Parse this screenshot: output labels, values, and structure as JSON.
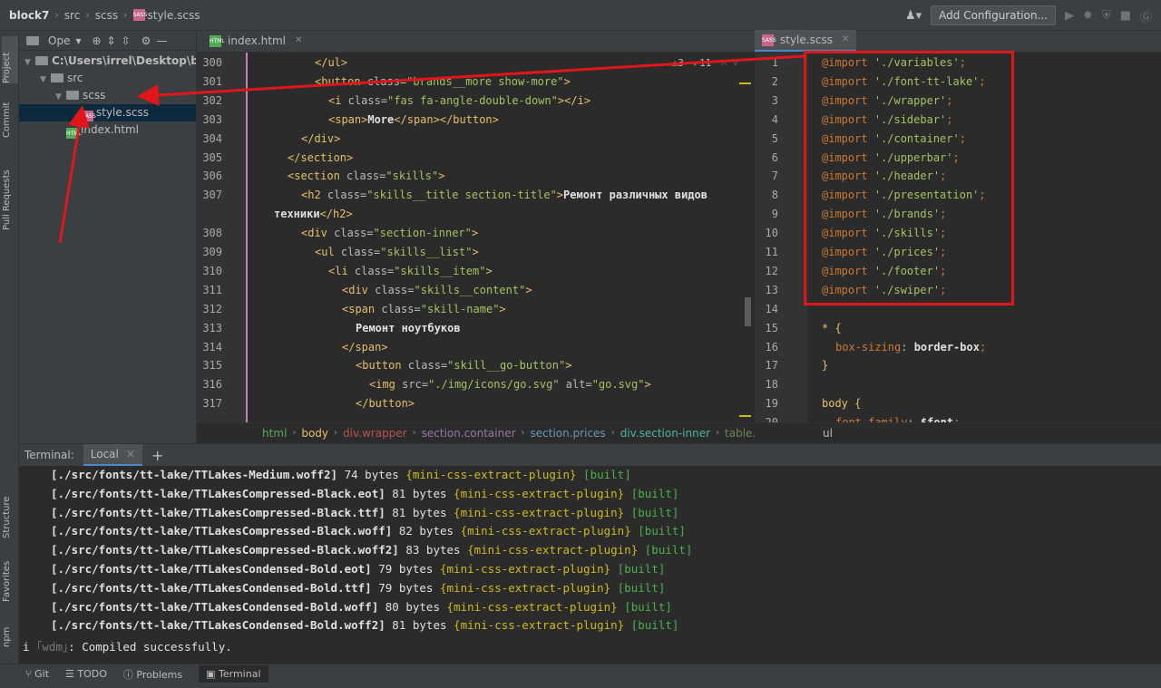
{
  "breadcrumbs": [
    "block7",
    "src",
    "scss",
    "style.scss"
  ],
  "toolbar": {
    "add_configuration": "Add Configuration..."
  },
  "left_strip": [
    "Project",
    "Commit",
    "Pull Requests",
    "Structure",
    "Favorites",
    "npm"
  ],
  "project": {
    "view_label": "Ope",
    "tree": [
      {
        "label": "C:\\Users\\irrel\\Desktop\\block7",
        "level": 0,
        "kind": "folder",
        "open": true
      },
      {
        "label": "src",
        "level": 1,
        "kind": "folder",
        "open": true
      },
      {
        "label": "scss",
        "level": 2,
        "kind": "folder",
        "open": true
      },
      {
        "label": "style.scss",
        "level": 3,
        "kind": "scss",
        "selected": true
      },
      {
        "label": "index.html",
        "level": 2,
        "kind": "html"
      }
    ]
  },
  "editor1": {
    "tab": "index.html",
    "inspection": {
      "warnings": "3",
      "ok": "11"
    },
    "lines": [
      {
        "n": "300",
        "indent": 5,
        "html": "</ul>"
      },
      {
        "n": "301",
        "indent": 5,
        "html": "<button class=\"brands__more show-more\">"
      },
      {
        "n": "302",
        "indent": 6,
        "html": "<i class=\"fas fa-angle-double-down\"></i>"
      },
      {
        "n": "303",
        "indent": 6,
        "html": "<span>More</span></button>"
      },
      {
        "n": "304",
        "indent": 4,
        "html": "</div>"
      },
      {
        "n": "305",
        "indent": 3,
        "html": "</section>"
      },
      {
        "n": "306",
        "indent": 3,
        "html": "<section class=\"skills\">"
      },
      {
        "n": "307",
        "indent": 4,
        "html": "<h2 class=\"skills__title section-title\">Ремонт различных видов"
      },
      {
        "n": "",
        "indent": 2,
        "html": "техники</h2>"
      },
      {
        "n": "308",
        "indent": 4,
        "html": "<div class=\"section-inner\">"
      },
      {
        "n": "309",
        "indent": 5,
        "html": "<ul class=\"skills__list\">"
      },
      {
        "n": "310",
        "indent": 6,
        "html": "<li class=\"skills__item\">"
      },
      {
        "n": "311",
        "indent": 7,
        "html": "<div class=\"skills__content\">"
      },
      {
        "n": "312",
        "indent": 7,
        "html": "<span class=\"skill-name\">"
      },
      {
        "n": "313",
        "indent": 8,
        "html": "Ремонт ноутбуков"
      },
      {
        "n": "314",
        "indent": 7,
        "html": "</span>"
      },
      {
        "n": "315",
        "indent": 8,
        "html": "<button class=\"skill__go-button\">"
      },
      {
        "n": "316",
        "indent": 9,
        "html": "<img src=\"./img/icons/go.svg\" alt=\"go.svg\">"
      },
      {
        "n": "317",
        "indent": 8,
        "html": "</button>"
      }
    ],
    "breadcrumb": [
      {
        "label": "html",
        "color": "#55ab55"
      },
      {
        "label": "body",
        "color": "#e8bf6a"
      },
      {
        "label": "div.wrapper",
        "color": "#b5554f"
      },
      {
        "label": "section.container",
        "color": "#9876aa"
      },
      {
        "label": "section.prices",
        "color": "#6897bb"
      },
      {
        "label": "div.section-inner",
        "color": "#4fb1a4"
      },
      {
        "label": "table.prices",
        "color": "#6a8759"
      }
    ]
  },
  "editor2": {
    "tab": "style.scss",
    "lines": [
      {
        "n": "1",
        "imp": "'./variables'"
      },
      {
        "n": "2",
        "imp": "'./font-tt-lake'"
      },
      {
        "n": "3",
        "imp": "'./wrapper'"
      },
      {
        "n": "4",
        "imp": "'./sidebar'"
      },
      {
        "n": "5",
        "imp": "'./container'"
      },
      {
        "n": "6",
        "imp": "'./upperbar'"
      },
      {
        "n": "7",
        "imp": "'./header'"
      },
      {
        "n": "8",
        "imp": "'./presentation'"
      },
      {
        "n": "9",
        "imp": "'./brands'"
      },
      {
        "n": "10",
        "imp": "'./skills'"
      },
      {
        "n": "11",
        "imp": "'./prices'"
      },
      {
        "n": "12",
        "imp": "'./footer'"
      },
      {
        "n": "13",
        "imp": "'./swiper'"
      },
      {
        "n": "14"
      },
      {
        "n": "15",
        "raw": "* {"
      },
      {
        "n": "16",
        "prop": "box-sizing",
        "value": "border-box"
      },
      {
        "n": "17",
        "raw": "}"
      },
      {
        "n": "18"
      },
      {
        "n": "19",
        "raw": "body {"
      },
      {
        "n": "20",
        "prop": "font-family",
        "value": "$font"
      }
    ],
    "import_keyword": "@import",
    "breadcrumb": "ul"
  },
  "terminal": {
    "label": "Terminal:",
    "tab": "Local",
    "lines": [
      {
        "path": "[./src/fonts/tt-lake/TTLakes-Medium.woff2]",
        "size": "74 bytes"
      },
      {
        "path": "[./src/fonts/tt-lake/TTLakesCompressed-Black.eot]",
        "size": "81 bytes"
      },
      {
        "path": "[./src/fonts/tt-lake/TTLakesCompressed-Black.ttf]",
        "size": "81 bytes"
      },
      {
        "path": "[./src/fonts/tt-lake/TTLakesCompressed-Black.woff]",
        "size": "82 bytes"
      },
      {
        "path": "[./src/fonts/tt-lake/TTLakesCompressed-Black.woff2]",
        "size": "83 bytes"
      },
      {
        "path": "[./src/fonts/tt-lake/TTLakesCondensed-Bold.eot]",
        "size": "79 bytes"
      },
      {
        "path": "[./src/fonts/tt-lake/TTLakesCondensed-Bold.ttf]",
        "size": "79 bytes"
      },
      {
        "path": "[./src/fonts/tt-lake/TTLakesCondensed-Bold.woff]",
        "size": "80 bytes"
      },
      {
        "path": "[./src/fonts/tt-lake/TTLakesCondensed-Bold.woff2]",
        "size": "81 bytes"
      }
    ],
    "plugin": "{mini-css-extract-plugin}",
    "built": "[built]",
    "final_prefix": "i",
    "final_wdm": "｢wdm｣",
    "final_text": ": Compiled successfully."
  },
  "bottom_tools": [
    "Git",
    "TODO",
    "Problems",
    "Terminal"
  ],
  "colors": {
    "annotation": "#e0161b",
    "accent": "#4a88c7"
  }
}
